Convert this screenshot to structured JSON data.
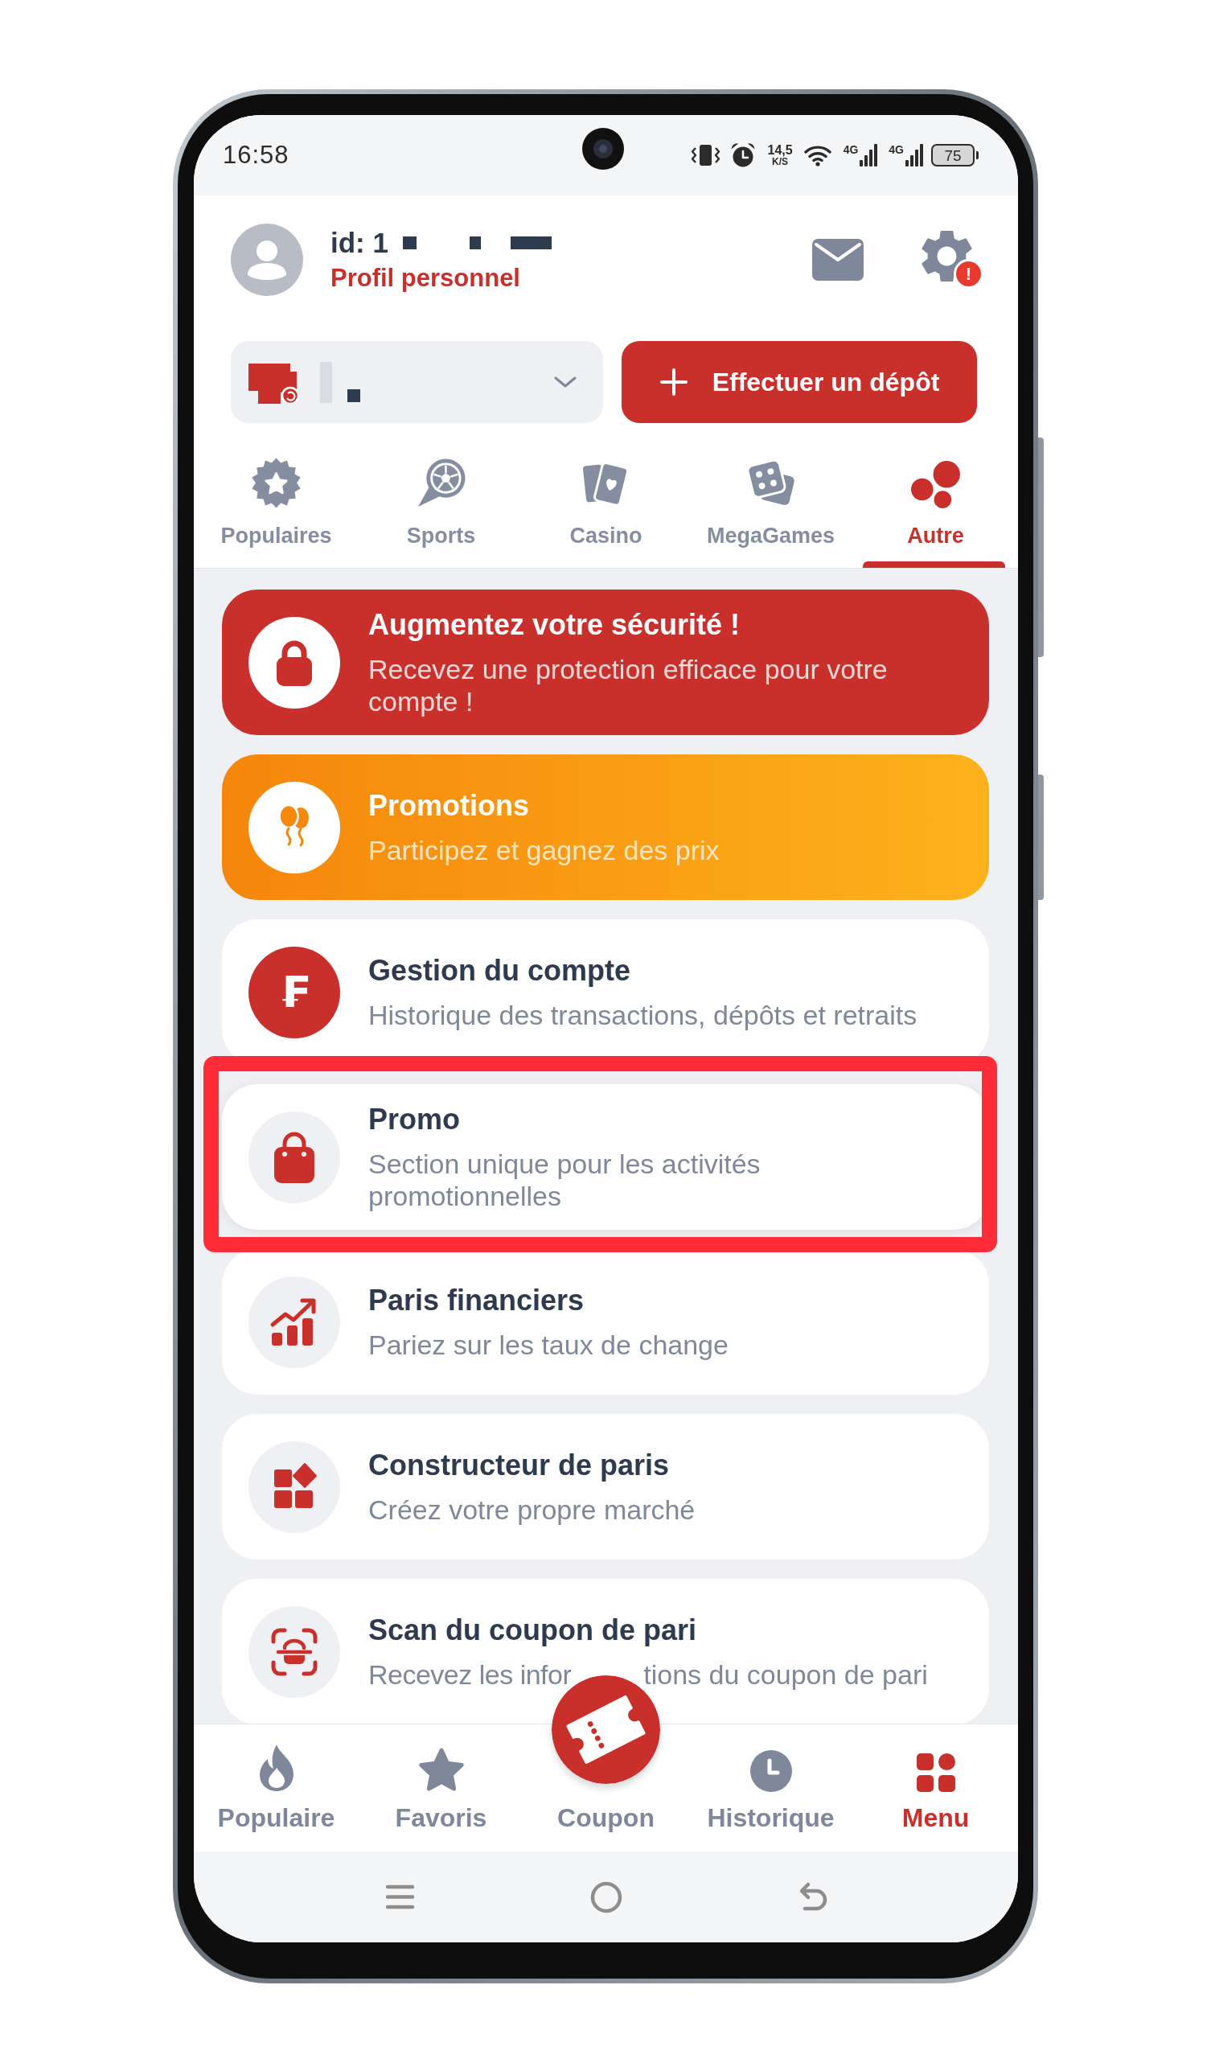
{
  "status_bar": {
    "time": "16:58",
    "speed": "14,5",
    "speed_unit": "K/S",
    "networks": [
      "4G",
      "4G"
    ],
    "battery": "75"
  },
  "profile": {
    "id": "id: 1",
    "link": "Profil personnel",
    "settings_badge": "!"
  },
  "deposit_button": {
    "label": "Effectuer un dépôt"
  },
  "tabs": [
    {
      "label": "Populaires",
      "selected": false
    },
    {
      "label": "Sports",
      "selected": false
    },
    {
      "label": "Casino",
      "selected": false
    },
    {
      "label": "MegaGames",
      "selected": false
    },
    {
      "label": "Autre",
      "selected": true
    }
  ],
  "menu_items": [
    {
      "kind": "alert",
      "title": "Augmentez votre sécurité !",
      "subtitle": "Recevez une protection efficace pour votre compte !",
      "highlighted": false
    },
    {
      "kind": "promotion",
      "title": "Promotions",
      "subtitle": "Participez et gagnez des prix",
      "highlighted": false
    },
    {
      "kind": "account",
      "symbol": "₣",
      "title": "Gestion du compte",
      "subtitle": "Historique des transactions, dépôts et retraits",
      "highlighted": false
    },
    {
      "kind": "feature",
      "title": "Promo",
      "subtitle": "Section unique pour les activités promotionnelles",
      "highlighted": true
    },
    {
      "kind": "feature",
      "title": "Paris financiers",
      "subtitle": "Pariez sur les taux de change",
      "highlighted": false
    },
    {
      "kind": "feature",
      "title": "Constructeur de paris",
      "subtitle": "Créez votre propre marché",
      "highlighted": false
    },
    {
      "kind": "feature",
      "title": "Scan du coupon de pari",
      "subtitle": "Recevez les infor",
      "subtitle_after_cover": "tions du coupon de pari",
      "highlighted": false
    }
  ],
  "bottom_nav": [
    {
      "kind": "tab",
      "label": "Populaire",
      "selected": false
    },
    {
      "kind": "tab",
      "label": "Favoris",
      "selected": false
    },
    {
      "kind": "fab",
      "label": "Coupon",
      "selected": false
    },
    {
      "kind": "tab",
      "label": "Historique",
      "selected": false
    },
    {
      "kind": "tab",
      "label": "Menu",
      "selected": true
    }
  ]
}
